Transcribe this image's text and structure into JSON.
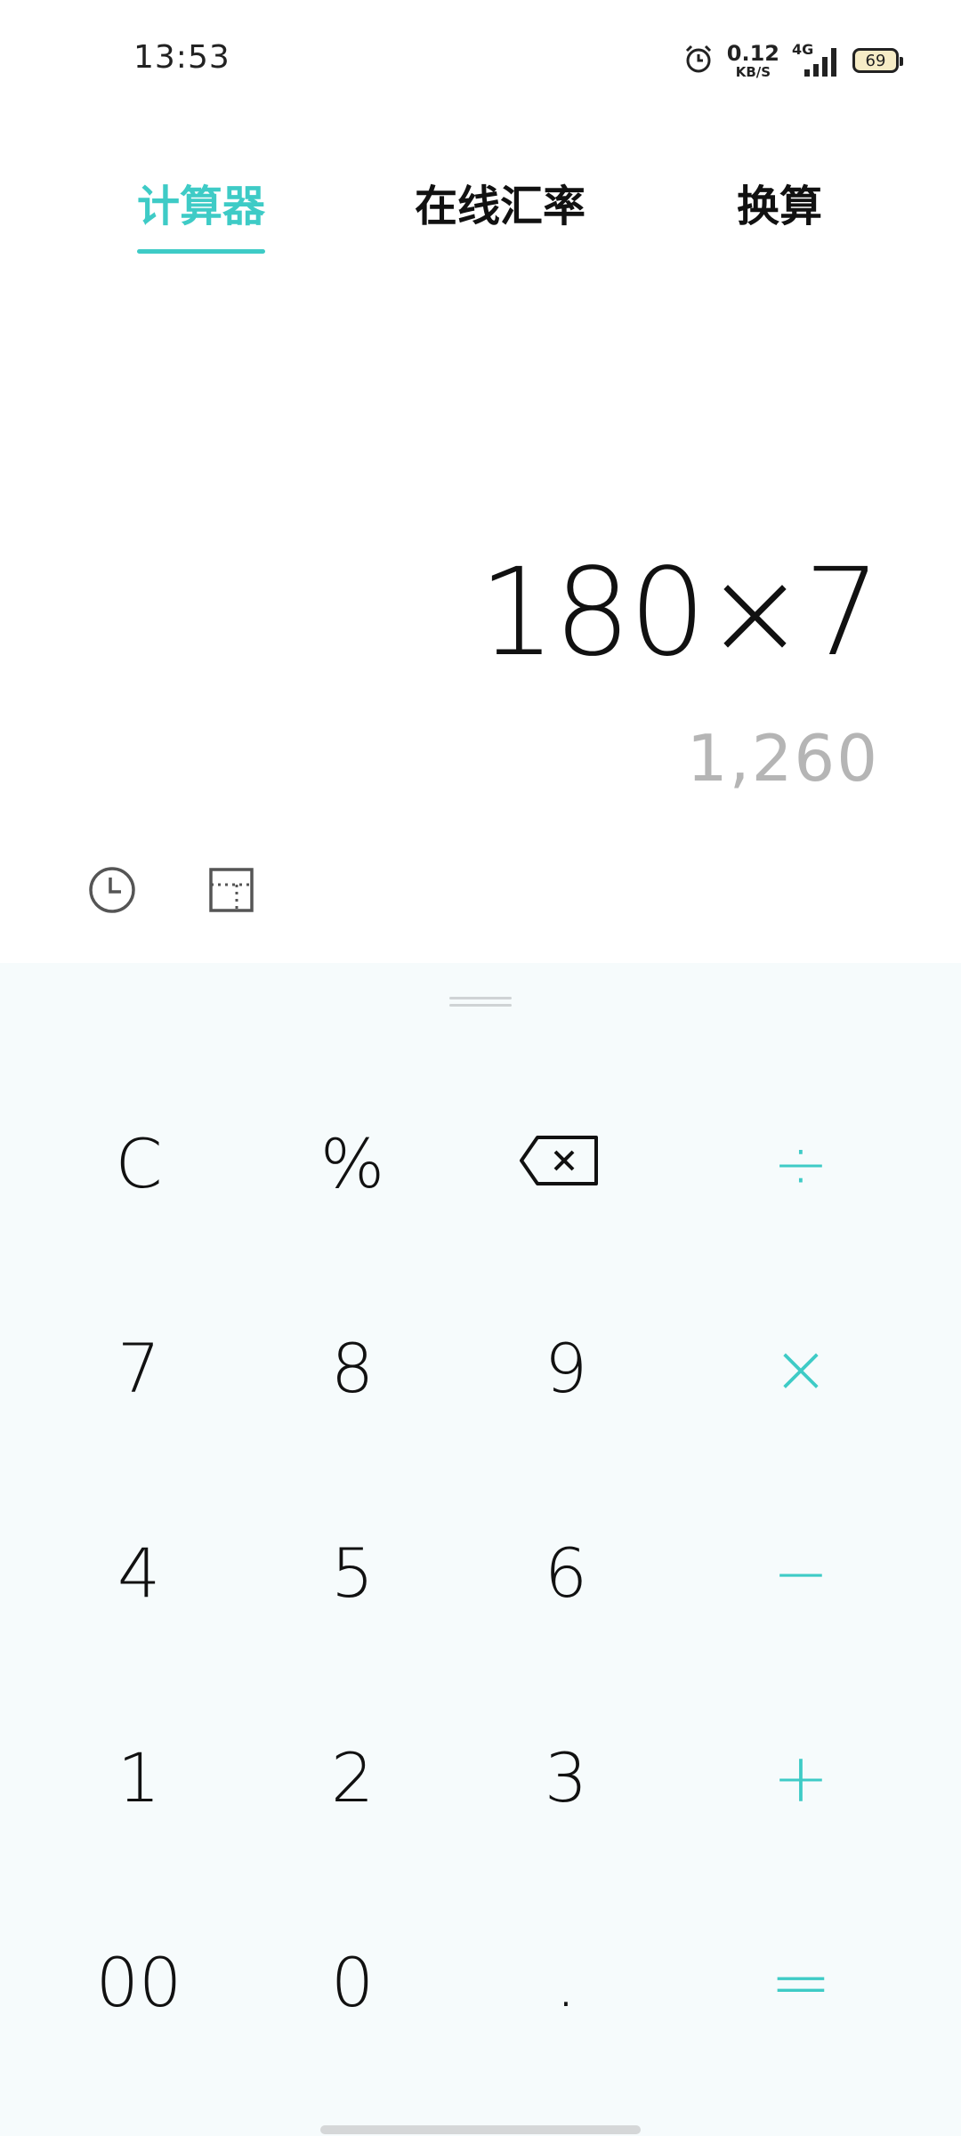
{
  "status_bar": {
    "time": "13:53",
    "net_speed_value": "0.12",
    "net_speed_unit": "KB/S",
    "network": "4G",
    "battery": "69",
    "icons": [
      "alarm-icon",
      "signal-icon",
      "battery-icon"
    ]
  },
  "tabs": [
    {
      "label": "计算器",
      "active": true
    },
    {
      "label": "在线汇率",
      "active": false
    },
    {
      "label": "换算",
      "active": false
    }
  ],
  "display": {
    "expression": "180×7",
    "result": "1,260"
  },
  "tools": {
    "history_icon": "history-clock-icon",
    "scientific_icon": "scientific-mode-icon"
  },
  "keypad": {
    "rows": [
      [
        "C",
        "%",
        "⌫",
        "÷"
      ],
      [
        "7",
        "8",
        "9",
        "×"
      ],
      [
        "4",
        "5",
        "6",
        "−"
      ],
      [
        "1",
        "2",
        "3",
        "+"
      ],
      [
        "00",
        "0",
        ".",
        "="
      ]
    ]
  },
  "colors": {
    "accent": "#3ecbc6",
    "keypad_bg": "#f6fbfc",
    "result_text": "#b5b5b5"
  }
}
